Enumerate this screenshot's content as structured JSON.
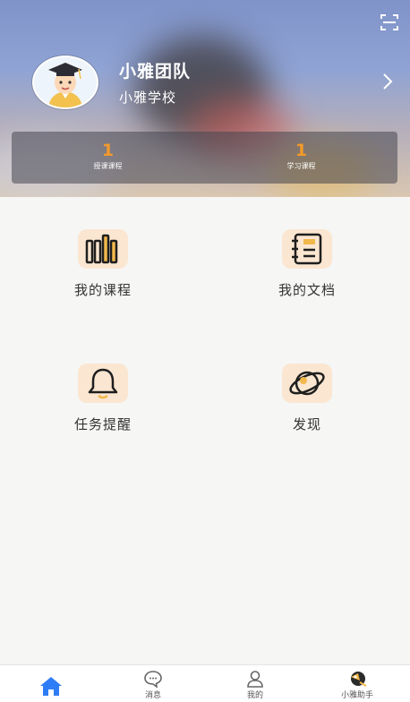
{
  "header": {
    "team_name": "小雅团队",
    "school": "小雅学校",
    "scan_icon": "scan-icon",
    "chevron_icon": "chevron-right-icon",
    "avatar": "avatar-graduate-icon"
  },
  "stats": [
    {
      "value": "1",
      "label": "授课课程"
    },
    {
      "value": "1",
      "label": "学习课程"
    }
  ],
  "grid": [
    {
      "label": "我的课程",
      "icon": "books-icon"
    },
    {
      "label": "我的文档",
      "icon": "document-icon"
    },
    {
      "label": "任务提醒",
      "icon": "bell-icon"
    },
    {
      "label": "发现",
      "icon": "planet-icon"
    }
  ],
  "tabbar": [
    {
      "label": "",
      "icon": "home-icon",
      "active": true
    },
    {
      "label": "消息",
      "icon": "chat-icon"
    },
    {
      "label": "我的",
      "icon": "user-icon"
    },
    {
      "label": "小雅助手",
      "icon": "assistant-bird-icon"
    }
  ],
  "colors": {
    "accent": "#f39a2b",
    "tab_active": "#2f7df6",
    "icon_bg": "#fbe6d1"
  }
}
